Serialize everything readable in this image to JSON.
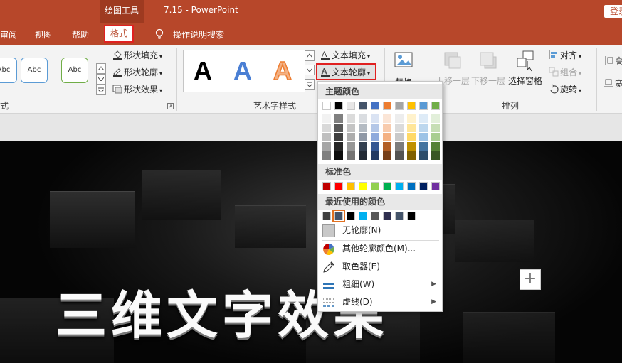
{
  "title_bar": {
    "context_tab": "绘图工具",
    "document_title": "7.15  -  PowerPoint",
    "login_label": "登录"
  },
  "tabs": {
    "review": "审阅",
    "view": "视图",
    "help": "帮助",
    "format": "格式",
    "tell_me": "操作说明搜索"
  },
  "ribbon": {
    "shape_styles": {
      "previews": [
        "Abc",
        "Abc",
        "Abc"
      ],
      "fill": "形状填充",
      "outline": "形状轮廓",
      "effects": "形状效果",
      "group_label_partial": "式"
    },
    "wordart_styles": {
      "letters": [
        "A",
        "A",
        "A"
      ],
      "text_fill": "文本填充",
      "text_outline": "文本轮廓",
      "group_label": "艺术字样式"
    },
    "alt_text": "替换",
    "arrange": {
      "bring_forward": "上移一层",
      "send_backward": "下移一层",
      "selection_pane": "选择窗格",
      "align": "对齐",
      "group": "组合",
      "rotate": "旋转",
      "group_label": "排列"
    },
    "size": {
      "height_partial": "高",
      "width_partial": "宽"
    }
  },
  "dropdown": {
    "theme_colors_header": "主题颜色",
    "standard_colors_header": "标准色",
    "recent_colors_header": "最近使用的颜色",
    "no_outline": "无轮廓(N)",
    "more_colors": "其他轮廓颜色(M)...",
    "eyedropper": "取色器(E)",
    "weight": "粗细(W)",
    "dashes": "虚线(D)",
    "theme_colors": [
      "#FFFFFF",
      "#000000",
      "#E7E6E6",
      "#44546A",
      "#4472C4",
      "#ED7D31",
      "#A5A5A5",
      "#FFC000",
      "#5B9BD5",
      "#70AD47"
    ],
    "standard_colors": [
      "#C00000",
      "#FF0000",
      "#FFC000",
      "#FFFF00",
      "#92D050",
      "#00B050",
      "#00B0F0",
      "#0070C0",
      "#002060",
      "#7030A0"
    ],
    "recent_colors": [
      "#404040",
      "#44546A",
      "#000000",
      "#00B0F0",
      "#595959",
      "#2F2F4F",
      "#44546A",
      "#000000"
    ]
  },
  "slide": {
    "title": "三维文字效果"
  }
}
